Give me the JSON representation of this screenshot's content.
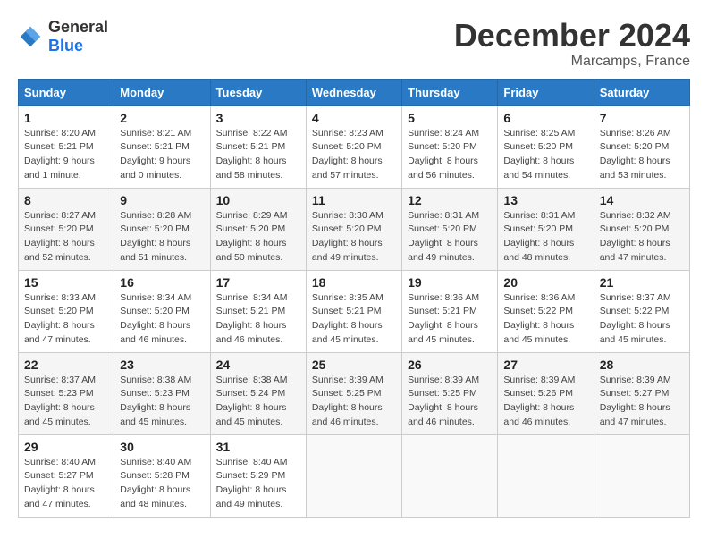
{
  "header": {
    "logo_general": "General",
    "logo_blue": "Blue",
    "title": "December 2024",
    "location": "Marcamps, France"
  },
  "weekdays": [
    "Sunday",
    "Monday",
    "Tuesday",
    "Wednesday",
    "Thursday",
    "Friday",
    "Saturday"
  ],
  "weeks": [
    [
      {
        "day": "1",
        "sunrise": "Sunrise: 8:20 AM",
        "sunset": "Sunset: 5:21 PM",
        "daylight": "Daylight: 9 hours and 1 minute."
      },
      {
        "day": "2",
        "sunrise": "Sunrise: 8:21 AM",
        "sunset": "Sunset: 5:21 PM",
        "daylight": "Daylight: 9 hours and 0 minutes."
      },
      {
        "day": "3",
        "sunrise": "Sunrise: 8:22 AM",
        "sunset": "Sunset: 5:21 PM",
        "daylight": "Daylight: 8 hours and 58 minutes."
      },
      {
        "day": "4",
        "sunrise": "Sunrise: 8:23 AM",
        "sunset": "Sunset: 5:20 PM",
        "daylight": "Daylight: 8 hours and 57 minutes."
      },
      {
        "day": "5",
        "sunrise": "Sunrise: 8:24 AM",
        "sunset": "Sunset: 5:20 PM",
        "daylight": "Daylight: 8 hours and 56 minutes."
      },
      {
        "day": "6",
        "sunrise": "Sunrise: 8:25 AM",
        "sunset": "Sunset: 5:20 PM",
        "daylight": "Daylight: 8 hours and 54 minutes."
      },
      {
        "day": "7",
        "sunrise": "Sunrise: 8:26 AM",
        "sunset": "Sunset: 5:20 PM",
        "daylight": "Daylight: 8 hours and 53 minutes."
      }
    ],
    [
      {
        "day": "8",
        "sunrise": "Sunrise: 8:27 AM",
        "sunset": "Sunset: 5:20 PM",
        "daylight": "Daylight: 8 hours and 52 minutes."
      },
      {
        "day": "9",
        "sunrise": "Sunrise: 8:28 AM",
        "sunset": "Sunset: 5:20 PM",
        "daylight": "Daylight: 8 hours and 51 minutes."
      },
      {
        "day": "10",
        "sunrise": "Sunrise: 8:29 AM",
        "sunset": "Sunset: 5:20 PM",
        "daylight": "Daylight: 8 hours and 50 minutes."
      },
      {
        "day": "11",
        "sunrise": "Sunrise: 8:30 AM",
        "sunset": "Sunset: 5:20 PM",
        "daylight": "Daylight: 8 hours and 49 minutes."
      },
      {
        "day": "12",
        "sunrise": "Sunrise: 8:31 AM",
        "sunset": "Sunset: 5:20 PM",
        "daylight": "Daylight: 8 hours and 49 minutes."
      },
      {
        "day": "13",
        "sunrise": "Sunrise: 8:31 AM",
        "sunset": "Sunset: 5:20 PM",
        "daylight": "Daylight: 8 hours and 48 minutes."
      },
      {
        "day": "14",
        "sunrise": "Sunrise: 8:32 AM",
        "sunset": "Sunset: 5:20 PM",
        "daylight": "Daylight: 8 hours and 47 minutes."
      }
    ],
    [
      {
        "day": "15",
        "sunrise": "Sunrise: 8:33 AM",
        "sunset": "Sunset: 5:20 PM",
        "daylight": "Daylight: 8 hours and 47 minutes."
      },
      {
        "day": "16",
        "sunrise": "Sunrise: 8:34 AM",
        "sunset": "Sunset: 5:20 PM",
        "daylight": "Daylight: 8 hours and 46 minutes."
      },
      {
        "day": "17",
        "sunrise": "Sunrise: 8:34 AM",
        "sunset": "Sunset: 5:21 PM",
        "daylight": "Daylight: 8 hours and 46 minutes."
      },
      {
        "day": "18",
        "sunrise": "Sunrise: 8:35 AM",
        "sunset": "Sunset: 5:21 PM",
        "daylight": "Daylight: 8 hours and 45 minutes."
      },
      {
        "day": "19",
        "sunrise": "Sunrise: 8:36 AM",
        "sunset": "Sunset: 5:21 PM",
        "daylight": "Daylight: 8 hours and 45 minutes."
      },
      {
        "day": "20",
        "sunrise": "Sunrise: 8:36 AM",
        "sunset": "Sunset: 5:22 PM",
        "daylight": "Daylight: 8 hours and 45 minutes."
      },
      {
        "day": "21",
        "sunrise": "Sunrise: 8:37 AM",
        "sunset": "Sunset: 5:22 PM",
        "daylight": "Daylight: 8 hours and 45 minutes."
      }
    ],
    [
      {
        "day": "22",
        "sunrise": "Sunrise: 8:37 AM",
        "sunset": "Sunset: 5:23 PM",
        "daylight": "Daylight: 8 hours and 45 minutes."
      },
      {
        "day": "23",
        "sunrise": "Sunrise: 8:38 AM",
        "sunset": "Sunset: 5:23 PM",
        "daylight": "Daylight: 8 hours and 45 minutes."
      },
      {
        "day": "24",
        "sunrise": "Sunrise: 8:38 AM",
        "sunset": "Sunset: 5:24 PM",
        "daylight": "Daylight: 8 hours and 45 minutes."
      },
      {
        "day": "25",
        "sunrise": "Sunrise: 8:39 AM",
        "sunset": "Sunset: 5:25 PM",
        "daylight": "Daylight: 8 hours and 46 minutes."
      },
      {
        "day": "26",
        "sunrise": "Sunrise: 8:39 AM",
        "sunset": "Sunset: 5:25 PM",
        "daylight": "Daylight: 8 hours and 46 minutes."
      },
      {
        "day": "27",
        "sunrise": "Sunrise: 8:39 AM",
        "sunset": "Sunset: 5:26 PM",
        "daylight": "Daylight: 8 hours and 46 minutes."
      },
      {
        "day": "28",
        "sunrise": "Sunrise: 8:39 AM",
        "sunset": "Sunset: 5:27 PM",
        "daylight": "Daylight: 8 hours and 47 minutes."
      }
    ],
    [
      {
        "day": "29",
        "sunrise": "Sunrise: 8:40 AM",
        "sunset": "Sunset: 5:27 PM",
        "daylight": "Daylight: 8 hours and 47 minutes."
      },
      {
        "day": "30",
        "sunrise": "Sunrise: 8:40 AM",
        "sunset": "Sunset: 5:28 PM",
        "daylight": "Daylight: 8 hours and 48 minutes."
      },
      {
        "day": "31",
        "sunrise": "Sunrise: 8:40 AM",
        "sunset": "Sunset: 5:29 PM",
        "daylight": "Daylight: 8 hours and 49 minutes."
      },
      null,
      null,
      null,
      null
    ]
  ]
}
